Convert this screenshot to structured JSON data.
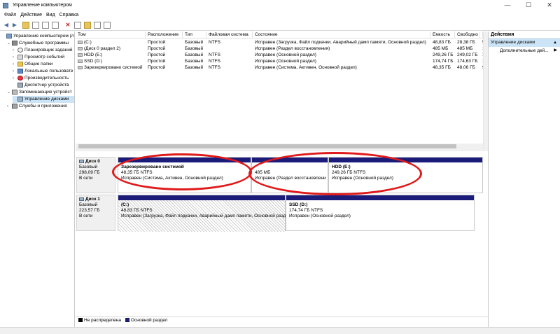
{
  "window": {
    "title": "Управление компьютером"
  },
  "menu": [
    "Файл",
    "Действие",
    "Вид",
    "Справка"
  ],
  "tree": [
    {
      "label": "Управление компьютером (л",
      "level": 0,
      "chev": "",
      "icon": "computer-icon"
    },
    {
      "label": "Служебные программы",
      "level": 1,
      "chev": "⌄",
      "icon": "tools-icon"
    },
    {
      "label": "Планировщик заданий",
      "level": 2,
      "chev": "›",
      "icon": "clock-icon"
    },
    {
      "label": "Просмотр событий",
      "level": 2,
      "chev": "›",
      "icon": "event-log-icon"
    },
    {
      "label": "Общие папки",
      "level": 2,
      "chev": "›",
      "icon": "shared-folder-icon"
    },
    {
      "label": "Локальные пользовате",
      "level": 2,
      "chev": "›",
      "icon": "users-icon"
    },
    {
      "label": "Производительность",
      "level": 2,
      "chev": "›",
      "icon": "performance-icon"
    },
    {
      "label": "Диспетчер устройств",
      "level": 2,
      "chev": "",
      "icon": "device-manager-icon"
    },
    {
      "label": "Запоминающие устройст",
      "level": 1,
      "chev": "⌄",
      "icon": "storage-icon"
    },
    {
      "label": "Управление дисками",
      "level": 2,
      "chev": "",
      "icon": "disk-management-icon",
      "selected": true
    },
    {
      "label": "Службы и приложения",
      "level": 1,
      "chev": "›",
      "icon": "services-icon"
    }
  ],
  "volumes": {
    "columns": [
      "Том",
      "Расположение",
      "Тип",
      "Файловая система",
      "Состояние",
      "Емкость",
      "Свободно",
      "С"
    ],
    "rows": [
      [
        "(C:)",
        "Простой",
        "Базовый",
        "NTFS",
        "Исправен (Загрузка, Файл подкачки, Аварийный дамп памяти, Основной раздел)",
        "48,83 ГБ",
        "28,38 ГБ",
        "5"
      ],
      [
        "(Диск 0 раздел 2)",
        "Простой",
        "Базовый",
        "",
        "Исправен (Раздел восстановления)",
        "485 МБ",
        "485 МБ",
        "1"
      ],
      [
        "HDD (E:)",
        "Простой",
        "Базовый",
        "NTFS",
        "Исправен (Основной раздел)",
        "249,26 ГБ",
        "249,02 ГБ",
        "1"
      ],
      [
        "SSD (D:)",
        "Простой",
        "Базовый",
        "NTFS",
        "Исправен (Основной раздел)",
        "174,74 ГБ",
        "174,63 ГБ",
        "1"
      ],
      [
        "Зарезервировано системой",
        "Простой",
        "Базовый",
        "NTFS",
        "Исправен (Система, Активен, Основной раздел)",
        "48,35 ГБ",
        "48,06 ГБ",
        "9"
      ]
    ]
  },
  "disks": [
    {
      "name": "Диск 0",
      "type": "Базовый",
      "size": "298,09 ГБ",
      "status": "В сети",
      "partitions": [
        {
          "name": "Зарезервировано системой",
          "size": "48,35 ГБ NTFS",
          "status": "Исправен (Система, Активен, Основной раздел)"
        },
        {
          "name": "",
          "size": "485 МБ",
          "status": "Исправен (Раздел восстановлени"
        },
        {
          "name": "HDD  (E:)",
          "size": "249,26 ГБ NTFS",
          "status": "Исправен (Основной раздел)"
        }
      ]
    },
    {
      "name": "Диск 1",
      "type": "Базовый",
      "size": "223,57 ГБ",
      "status": "В сети",
      "partitions": [
        {
          "name": "(C:)",
          "size": "48,83 ГБ NTFS",
          "status": "Исправен (Загрузка, Файл подкачки, Аварийный дамп памяти, Основной раздел)"
        },
        {
          "name": "SSD  (D:)",
          "size": "174,74 ГБ NTFS",
          "status": "Исправен (Основной раздел)"
        }
      ]
    }
  ],
  "legend": {
    "unallocated": "Не распределена",
    "primary": "Основной раздел"
  },
  "actions": {
    "header": "Действия",
    "selected": "Управление дисками",
    "more": "Дополнительные дей..."
  },
  "colors": {
    "primary_bar": "#1b1b7a",
    "annotation": "#e01a1a",
    "selection": "#cce4f7"
  }
}
